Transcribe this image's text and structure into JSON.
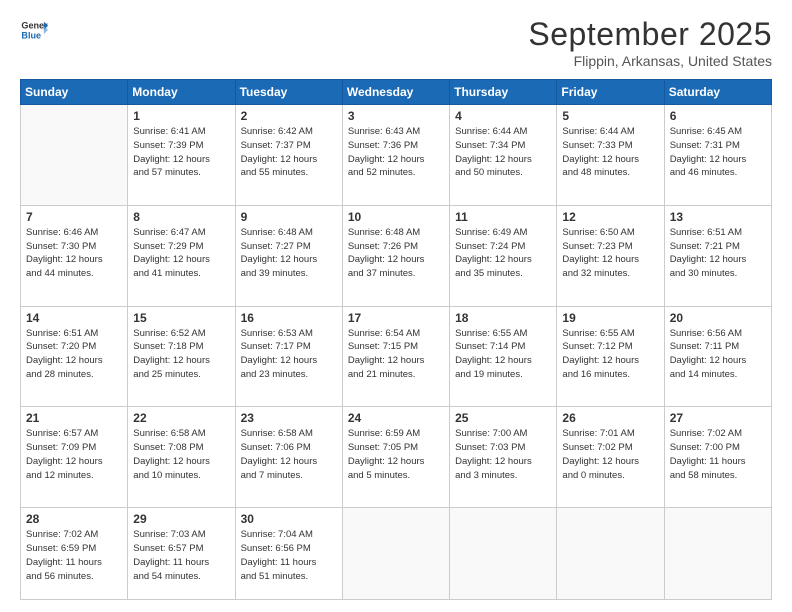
{
  "header": {
    "logo_line1": "General",
    "logo_line2": "Blue",
    "title": "September 2025",
    "subtitle": "Flippin, Arkansas, United States"
  },
  "weekdays": [
    "Sunday",
    "Monday",
    "Tuesday",
    "Wednesday",
    "Thursday",
    "Friday",
    "Saturday"
  ],
  "weeks": [
    [
      {
        "day": "",
        "info": ""
      },
      {
        "day": "1",
        "info": "Sunrise: 6:41 AM\nSunset: 7:39 PM\nDaylight: 12 hours\nand 57 minutes."
      },
      {
        "day": "2",
        "info": "Sunrise: 6:42 AM\nSunset: 7:37 PM\nDaylight: 12 hours\nand 55 minutes."
      },
      {
        "day": "3",
        "info": "Sunrise: 6:43 AM\nSunset: 7:36 PM\nDaylight: 12 hours\nand 52 minutes."
      },
      {
        "day": "4",
        "info": "Sunrise: 6:44 AM\nSunset: 7:34 PM\nDaylight: 12 hours\nand 50 minutes."
      },
      {
        "day": "5",
        "info": "Sunrise: 6:44 AM\nSunset: 7:33 PM\nDaylight: 12 hours\nand 48 minutes."
      },
      {
        "day": "6",
        "info": "Sunrise: 6:45 AM\nSunset: 7:31 PM\nDaylight: 12 hours\nand 46 minutes."
      }
    ],
    [
      {
        "day": "7",
        "info": "Sunrise: 6:46 AM\nSunset: 7:30 PM\nDaylight: 12 hours\nand 44 minutes."
      },
      {
        "day": "8",
        "info": "Sunrise: 6:47 AM\nSunset: 7:29 PM\nDaylight: 12 hours\nand 41 minutes."
      },
      {
        "day": "9",
        "info": "Sunrise: 6:48 AM\nSunset: 7:27 PM\nDaylight: 12 hours\nand 39 minutes."
      },
      {
        "day": "10",
        "info": "Sunrise: 6:48 AM\nSunset: 7:26 PM\nDaylight: 12 hours\nand 37 minutes."
      },
      {
        "day": "11",
        "info": "Sunrise: 6:49 AM\nSunset: 7:24 PM\nDaylight: 12 hours\nand 35 minutes."
      },
      {
        "day": "12",
        "info": "Sunrise: 6:50 AM\nSunset: 7:23 PM\nDaylight: 12 hours\nand 32 minutes."
      },
      {
        "day": "13",
        "info": "Sunrise: 6:51 AM\nSunset: 7:21 PM\nDaylight: 12 hours\nand 30 minutes."
      }
    ],
    [
      {
        "day": "14",
        "info": "Sunrise: 6:51 AM\nSunset: 7:20 PM\nDaylight: 12 hours\nand 28 minutes."
      },
      {
        "day": "15",
        "info": "Sunrise: 6:52 AM\nSunset: 7:18 PM\nDaylight: 12 hours\nand 25 minutes."
      },
      {
        "day": "16",
        "info": "Sunrise: 6:53 AM\nSunset: 7:17 PM\nDaylight: 12 hours\nand 23 minutes."
      },
      {
        "day": "17",
        "info": "Sunrise: 6:54 AM\nSunset: 7:15 PM\nDaylight: 12 hours\nand 21 minutes."
      },
      {
        "day": "18",
        "info": "Sunrise: 6:55 AM\nSunset: 7:14 PM\nDaylight: 12 hours\nand 19 minutes."
      },
      {
        "day": "19",
        "info": "Sunrise: 6:55 AM\nSunset: 7:12 PM\nDaylight: 12 hours\nand 16 minutes."
      },
      {
        "day": "20",
        "info": "Sunrise: 6:56 AM\nSunset: 7:11 PM\nDaylight: 12 hours\nand 14 minutes."
      }
    ],
    [
      {
        "day": "21",
        "info": "Sunrise: 6:57 AM\nSunset: 7:09 PM\nDaylight: 12 hours\nand 12 minutes."
      },
      {
        "day": "22",
        "info": "Sunrise: 6:58 AM\nSunset: 7:08 PM\nDaylight: 12 hours\nand 10 minutes."
      },
      {
        "day": "23",
        "info": "Sunrise: 6:58 AM\nSunset: 7:06 PM\nDaylight: 12 hours\nand 7 minutes."
      },
      {
        "day": "24",
        "info": "Sunrise: 6:59 AM\nSunset: 7:05 PM\nDaylight: 12 hours\nand 5 minutes."
      },
      {
        "day": "25",
        "info": "Sunrise: 7:00 AM\nSunset: 7:03 PM\nDaylight: 12 hours\nand 3 minutes."
      },
      {
        "day": "26",
        "info": "Sunrise: 7:01 AM\nSunset: 7:02 PM\nDaylight: 12 hours\nand 0 minutes."
      },
      {
        "day": "27",
        "info": "Sunrise: 7:02 AM\nSunset: 7:00 PM\nDaylight: 11 hours\nand 58 minutes."
      }
    ],
    [
      {
        "day": "28",
        "info": "Sunrise: 7:02 AM\nSunset: 6:59 PM\nDaylight: 11 hours\nand 56 minutes."
      },
      {
        "day": "29",
        "info": "Sunrise: 7:03 AM\nSunset: 6:57 PM\nDaylight: 11 hours\nand 54 minutes."
      },
      {
        "day": "30",
        "info": "Sunrise: 7:04 AM\nSunset: 6:56 PM\nDaylight: 11 hours\nand 51 minutes."
      },
      {
        "day": "",
        "info": ""
      },
      {
        "day": "",
        "info": ""
      },
      {
        "day": "",
        "info": ""
      },
      {
        "day": "",
        "info": ""
      }
    ]
  ]
}
